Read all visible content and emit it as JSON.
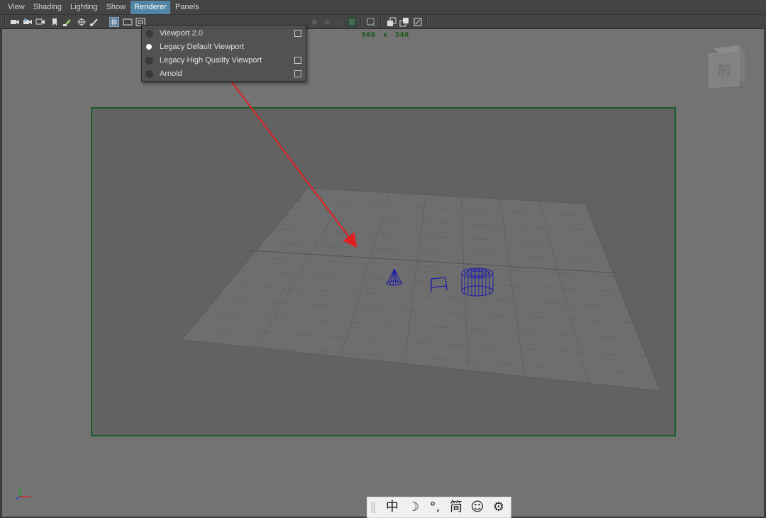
{
  "menubar": {
    "items": [
      "View",
      "Shading",
      "Lighting",
      "Show",
      "Renderer",
      "Panels"
    ],
    "active_index": 4
  },
  "viewport": {
    "resolution_w": "960",
    "resolution_x": "x",
    "resolution_h": "540",
    "viewcube_label": "前"
  },
  "renderer_menu": {
    "items": [
      {
        "label": "Viewport 2.0",
        "selected": false,
        "has_option_box": true
      },
      {
        "label": "Legacy Default Viewport",
        "selected": true,
        "has_option_box": false
      },
      {
        "label": "Legacy High Quality Viewport",
        "selected": false,
        "has_option_box": true
      },
      {
        "label": "Arnold",
        "selected": false,
        "has_option_box": true
      }
    ]
  },
  "ime_toolbar": {
    "mode": "中",
    "moon": "☽",
    "punct": "°,",
    "script": "简",
    "emoji": "☺",
    "settings": "⚙"
  },
  "colors": {
    "accent": "#5285a6",
    "gate_border": "#1a5c2a",
    "wireframe": "#1c1ca8",
    "annotation_arrow": "#e02020"
  }
}
